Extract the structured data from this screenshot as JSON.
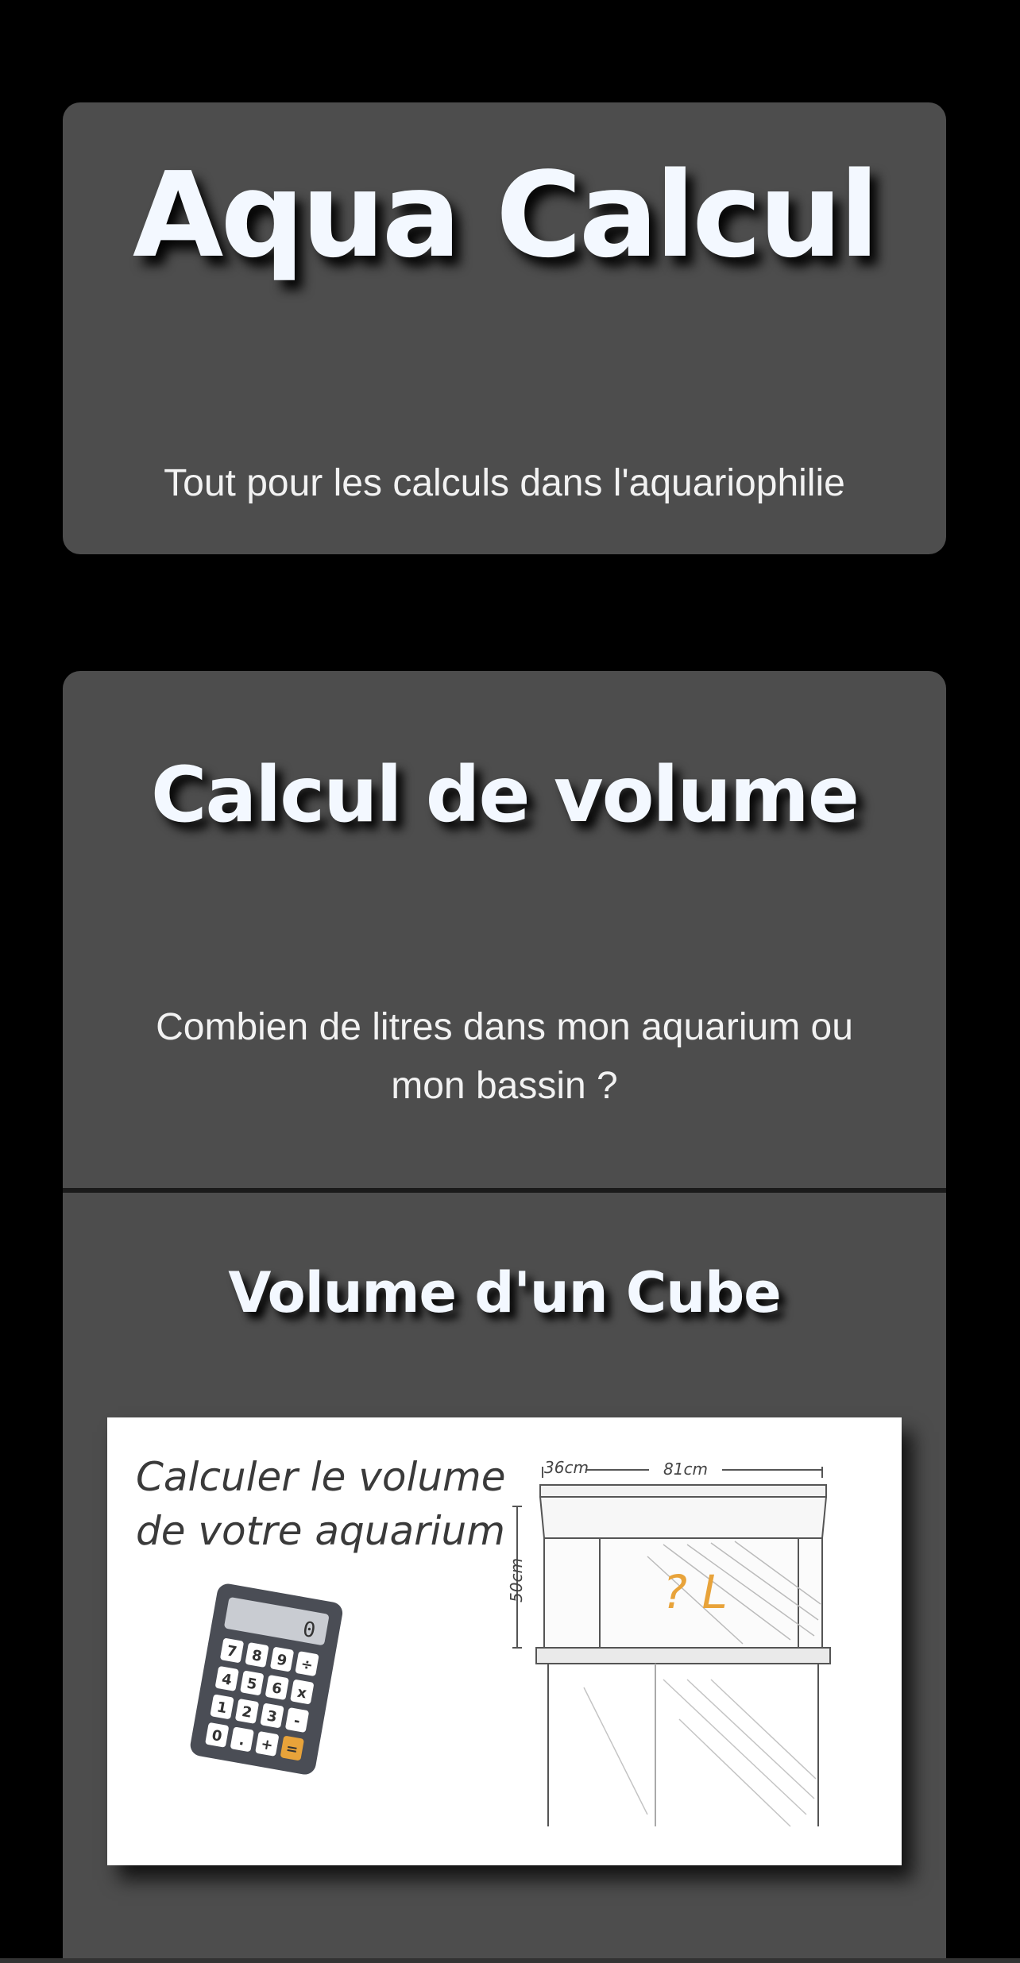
{
  "hero": {
    "title": "Aqua Calcul",
    "subtitle": "Tout pour les calculs dans l'aquariophilie"
  },
  "volume_section": {
    "title": "Calcul de volume",
    "description": "Combien de litres dans mon aquarium ou mon bassin ?"
  },
  "cube_section": {
    "title": "Volume d'un Cube",
    "illustration": {
      "heading_line1": "Calculer le volume",
      "heading_line2": "de votre aquarium",
      "depth_label": "36cm",
      "width_label": "81cm",
      "height_label": "50cm",
      "volume_label": "? L",
      "calculator_display": "0",
      "calculator_keys": [
        "7",
        "8",
        "9",
        "÷",
        "4",
        "5",
        "6",
        "x",
        "1",
        "2",
        "3",
        "-",
        "0",
        ".",
        "+",
        "="
      ]
    }
  },
  "colors": {
    "background": "#000000",
    "card": "#4d4d4d",
    "title_text": "#f3f8ff",
    "body_text": "#f2f2f2",
    "accent_orange": "#e8a33a"
  }
}
